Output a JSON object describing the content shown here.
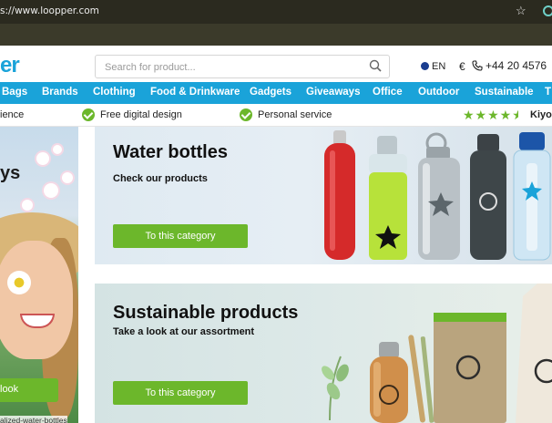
{
  "browser": {
    "url": "s://www.loopper.com"
  },
  "header": {
    "logo_fragment": "er",
    "search_placeholder": "Search for product...",
    "language": "EN",
    "currency": "€",
    "phone": "+44 20 4576"
  },
  "nav": {
    "items": [
      "Bags",
      "Brands",
      "Clothing",
      "Food & Drinkware",
      "Gadgets",
      "Giveaways",
      "Office",
      "Outdoor",
      "Sustainable",
      "T"
    ]
  },
  "usp": {
    "items": [
      "ience",
      "Free digital design",
      "Personal service"
    ],
    "rating_stars": 4.5,
    "rating_label": "Kiyo"
  },
  "hero": {
    "title_fragment": "ys",
    "button_label": "look",
    "caption": "alized-water-bottles"
  },
  "categories": [
    {
      "title": "Water bottles",
      "subtitle": "Check our products",
      "cta": "To this category"
    },
    {
      "title": "Sustainable products",
      "subtitle": "Take a look at our assortment",
      "cta": "To this category"
    }
  ],
  "colors": {
    "brand_blue": "#1aa3d9",
    "accent_green": "#6cb72b",
    "browser_bar": "#2b2a1f"
  }
}
